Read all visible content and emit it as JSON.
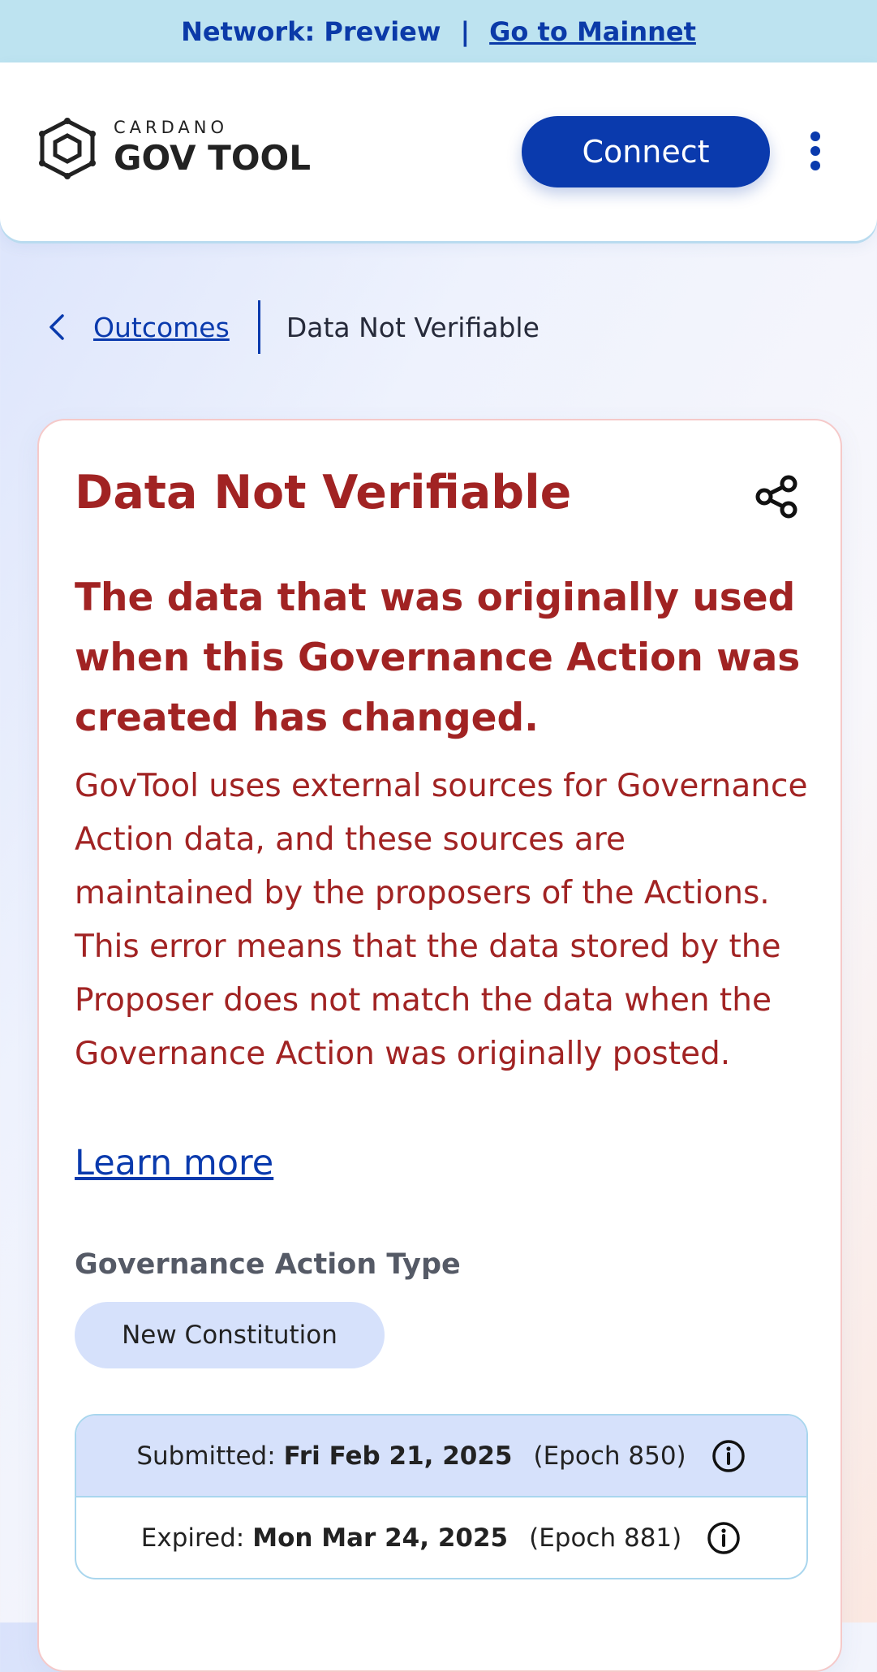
{
  "banner": {
    "network_text": "Network: Preview",
    "separator": "|",
    "mainnet_link": "Go to Mainnet"
  },
  "header": {
    "logo_small": "CARDANO",
    "logo_big": "GOV TOOL",
    "connect_label": "Connect",
    "menu_icon": "kebab-menu-icon"
  },
  "breadcrumb": {
    "back_icon": "chevron-left-icon",
    "parent": "Outcomes",
    "current": "Data Not Verifiable"
  },
  "card": {
    "title": "Data Not Verifiable",
    "share_icon": "share-icon",
    "headline": "The data that was originally used when this Governance Action was created has changed.",
    "description": "GovTool uses external sources for Governance Action data, and these sources are maintained by the proposers of the Actions. This error means that the data stored by the Proposer does not match the data when the Governance Action was originally posted.",
    "learn_more": "Learn more",
    "type_label": "Governance Action Type",
    "type_value": "New Constitution",
    "submitted": {
      "label": "Submitted:",
      "date": "Fri Feb 21, 2025",
      "epoch": "(Epoch 850)"
    },
    "expired": {
      "label": "Expired:",
      "date": "Mon Mar 24, 2025",
      "epoch": "(Epoch 881)"
    }
  },
  "colors": {
    "brand": "#0a3aad",
    "error": "#a12323",
    "banner": "#bde3f0",
    "chip": "#d6e1fb"
  }
}
